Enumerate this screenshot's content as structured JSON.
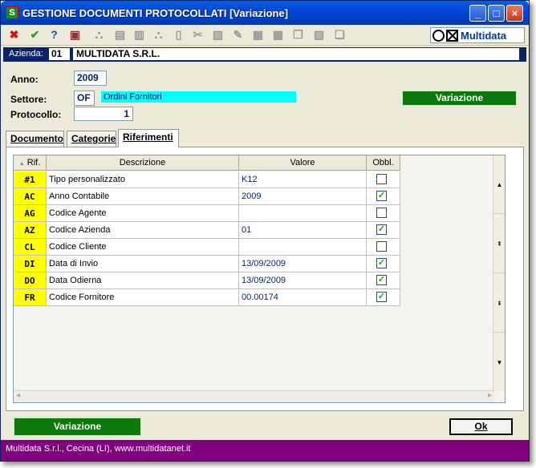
{
  "window": {
    "title": "GESTIONE DOCUMENTI PROTOCOLLATI [Variazione]",
    "app_icon": "S",
    "min": "_",
    "max": "□",
    "close": "×"
  },
  "toolbar": {
    "logo": "Multidata",
    "tools": [
      {
        "name": "delete-icon",
        "glyph": "✖",
        "color": "#d01010"
      },
      {
        "name": "check-icon",
        "glyph": "✔",
        "color": "#2ea02e"
      },
      {
        "name": "help-icon",
        "glyph": "?",
        "color": "#1a4fc0"
      },
      {
        "name": "book-icon",
        "glyph": "▣",
        "color": "#9b2a3a"
      },
      {
        "name": "find-icon",
        "glyph": "⛬",
        "color": "#9a9a9a"
      },
      {
        "name": "print-icon",
        "glyph": "▤",
        "color": "#9a9a9a"
      },
      {
        "name": "print-preview-icon",
        "glyph": "▥",
        "color": "#9a9a9a"
      },
      {
        "name": "binoculars-icon",
        "glyph": "⛬",
        "color": "#9a9a9a"
      },
      {
        "name": "new-document-icon",
        "glyph": "▯",
        "color": "#9a9a9a"
      },
      {
        "name": "cut-icon",
        "glyph": "✂",
        "color": "#9a9a9a"
      },
      {
        "name": "image-icon",
        "glyph": "▨",
        "color": "#9a9a9a"
      },
      {
        "name": "edit-icon",
        "glyph": "✎",
        "color": "#9a9a9a"
      },
      {
        "name": "paste-icon",
        "glyph": "▦",
        "color": "#9a9a9a"
      },
      {
        "name": "table-icon",
        "glyph": "▦",
        "color": "#9a9a9a"
      },
      {
        "name": "copy-icon",
        "glyph": "❐",
        "color": "#9a9a9a"
      },
      {
        "name": "export-icon",
        "glyph": "▧",
        "color": "#9a9a9a"
      },
      {
        "name": "clipboard-icon",
        "glyph": "❏",
        "color": "#9a9a9a"
      }
    ]
  },
  "azienda": {
    "label": "Azienda:",
    "code": "01",
    "name": "MULTIDATA S.R.L."
  },
  "form": {
    "anno_label": "Anno:",
    "anno_value": "2009",
    "settore_label": "Settore:",
    "settore_code": "OF",
    "settore_desc": "Ordini Fornitori",
    "protocollo_label": "Protocollo:",
    "protocollo_value": "1",
    "mode_badge": "Variazione"
  },
  "tabs": [
    {
      "label": "Documento"
    },
    {
      "label": "Categorie"
    },
    {
      "label": "Riferimenti"
    }
  ],
  "active_tab": "Riferimenti",
  "grid": {
    "headers": {
      "rif": "Rif.",
      "sort_icon": "▲",
      "descrizione": "Descrizione",
      "valore": "Valore",
      "obbl": "Obbl."
    },
    "rows": [
      {
        "rif": "#1",
        "descrizione": "Tipo personalizzato",
        "valore": "K12",
        "obbl": false
      },
      {
        "rif": "AC",
        "descrizione": "Anno Contabile",
        "valore": "2009",
        "obbl": true
      },
      {
        "rif": "AG",
        "descrizione": "Codice Agente",
        "valore": "",
        "obbl": false
      },
      {
        "rif": "AZ",
        "descrizione": "Codice Azienda",
        "valore": "01",
        "obbl": true
      },
      {
        "rif": "CL",
        "descrizione": "Codice Cliente",
        "valore": "",
        "obbl": false
      },
      {
        "rif": "DI",
        "descrizione": "Data di Invio",
        "valore": "13/09/2009",
        "obbl": true
      },
      {
        "rif": "DO",
        "descrizione": "Data Odierna",
        "valore": "13/09/2009",
        "obbl": true
      },
      {
        "rif": "FR",
        "descrizione": "Codice Fornitore",
        "valore": "00.00174",
        "obbl": true
      }
    ],
    "scroll": {
      "up": "▲",
      "page_up": "⇞",
      "page_down": "⇟",
      "down": "▼",
      "left": "◂",
      "right": "▸"
    }
  },
  "footer": {
    "mode_button": "Variazione",
    "ok_button": "Ok"
  },
  "statusbar": {
    "text": "Multidata S.r.l., Cecina (LI), www.multidatanet.it"
  },
  "colors": {
    "titlebar": "#0047d2",
    "status_bg": "#800080",
    "rif_bg": "#ffff00",
    "badge_green": "#0b7a0b",
    "settore_desc_bg": "#00ffff",
    "azienda_bg": "#0a246a"
  }
}
